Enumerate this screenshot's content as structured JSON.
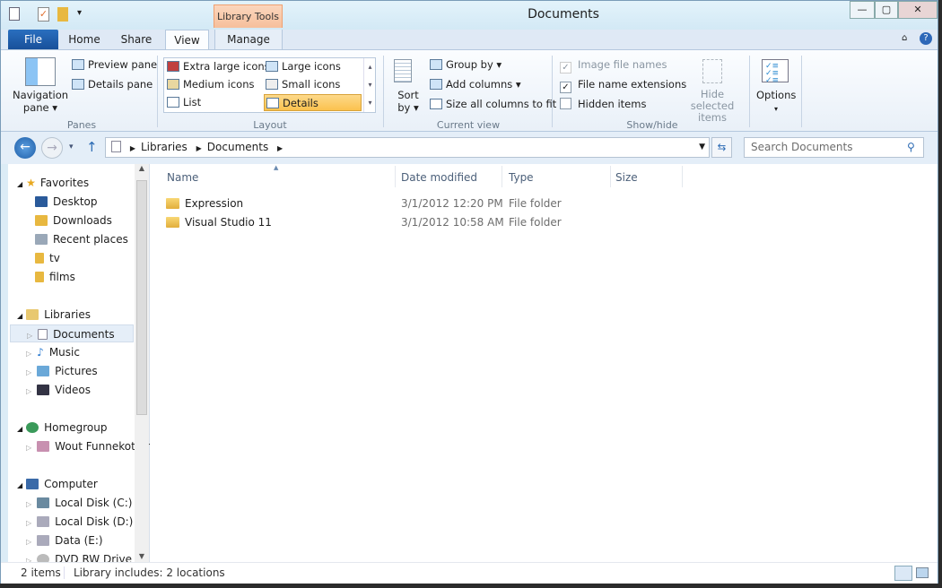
{
  "window": {
    "title": "Documents",
    "context_tab": "Library Tools",
    "minimize": "—",
    "maximize": "▢",
    "close": "✕"
  },
  "tabs": {
    "file": "File",
    "home": "Home",
    "share": "Share",
    "view": "View",
    "manage": "Manage"
  },
  "ribbon": {
    "panes": {
      "label": "Panes",
      "navigation_pane": "Navigation pane ▾",
      "preview_pane": "Preview pane",
      "details_pane": "Details pane"
    },
    "layout": {
      "label": "Layout",
      "items": [
        "Extra large icons",
        "Large icons",
        "Medium icons",
        "Small icons",
        "List",
        "Details"
      ],
      "selected": "Details"
    },
    "current_view": {
      "label": "Current view",
      "sort_by": "Sort by ▾",
      "group_by": "Group by ▾",
      "add_columns": "Add columns ▾",
      "size_columns": "Size all columns to fit"
    },
    "show_hide": {
      "label": "Show/hide",
      "image_file_names": "Image file names",
      "file_name_extensions": "File name extensions",
      "hidden_items": "Hidden items",
      "hide_selected": "Hide selected items",
      "image_file_names_checked": true,
      "file_name_extensions_checked": true,
      "hidden_items_checked": false
    },
    "options": "Options"
  },
  "address": {
    "path": [
      "Libraries",
      "Documents"
    ],
    "search_placeholder": "Search Documents"
  },
  "nav": {
    "favorites": {
      "label": "Favorites",
      "items": [
        "Desktop",
        "Downloads",
        "Recent places",
        "tv",
        "films"
      ]
    },
    "libraries": {
      "label": "Libraries",
      "items": [
        "Documents",
        "Music",
        "Pictures",
        "Videos"
      ],
      "selected": "Documents"
    },
    "homegroup": {
      "label": "Homegroup",
      "items": [
        "Wout Funnekotter"
      ]
    },
    "computer": {
      "label": "Computer",
      "items": [
        "Local Disk (C:)",
        "Local Disk (D:)",
        "Data (E:)",
        "DVD RW Drive (K:)"
      ]
    }
  },
  "columns": [
    "Name",
    "Date modified",
    "Type",
    "Size"
  ],
  "files": [
    {
      "name": "Expression",
      "date": "3/1/2012 12:20 PM",
      "type": "File folder",
      "size": ""
    },
    {
      "name": "Visual Studio 11",
      "date": "3/1/2012 10:58 AM",
      "type": "File folder",
      "size": ""
    }
  ],
  "status": {
    "count": "2 items",
    "library": "Library includes: 2 locations"
  }
}
